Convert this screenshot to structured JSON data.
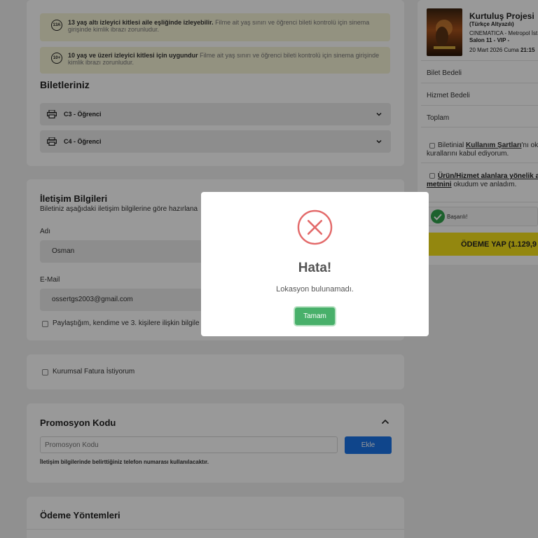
{
  "notices": [
    {
      "badge": "13A",
      "bold": "13 yaş altı izleyici kitlesi aile eşliğinde izleyebilir.",
      "text": " Filme ait yaş sınırı ve öğrenci bileti kontrolü için sinema girişinde kimlik ibrazı zorunludur."
    },
    {
      "badge": "10+",
      "bold": "10 yaş ve üzeri izleyici kitlesi için uygundur",
      "text": " Filme ait yaş sınırı ve öğrenci bileti kontrolü için sinema girişinde kimlik ibrazı zorunludur."
    }
  ],
  "tickets": {
    "heading": "Biletleriniz",
    "items": [
      {
        "label": "C3 - Öğrenci"
      },
      {
        "label": "C4 - Öğrenci"
      }
    ]
  },
  "contact": {
    "heading": "İletişim Bilgileri",
    "subtitle": "Biletiniz aşağıdaki iletişim bilgilerine göre hazırlana",
    "name_label": "Adı",
    "name_value": "Osman",
    "email_label": "E-Mail",
    "email_value": "ossertgs2003@gmail.com",
    "consent": "Paylaştığım, kendime ve 3. kişilere ilişkin bilgile"
  },
  "invoice": {
    "label": "Kurumsal Fatura İstiyorum"
  },
  "promo": {
    "heading": "Promosyon Kodu",
    "placeholder": "Promosyon Kodu",
    "apply_label": "Ekle",
    "note": "İletişim bilgilerinde belirttiğiniz telefon numarası kullanılacaktır."
  },
  "payment": {
    "heading": "Ödeme Yöntemleri"
  },
  "movie": {
    "title": "Kurtuluş Projesi",
    "subtitle": "(Türkçe Altyazılı)",
    "cinema": "CINEMATICA - Metropol İst",
    "hall": "Salon 11 - VIP -",
    "date": "20 Mart 2026 Cuma",
    "time": "21:15"
  },
  "summary": {
    "ticket_fee": "Bilet Bedeli",
    "service_fee": "Hizmet Bedeli",
    "total": "Toplam"
  },
  "terms": {
    "t1_pre": "Biletinial ",
    "t1_link": "Kullanım Şartları",
    "t1_post": "'nı ok",
    "t1_line2": "kurallarını kabul ediyorum.",
    "t2_link": "Ürün/Hizmet alanlara yönelik ay",
    "t2_link2": "metnini",
    "t2_post": " okudum ve anladım."
  },
  "captcha": {
    "label": "Başarılı!"
  },
  "pay_button": "ÖDEME YAP (1.129,9",
  "modal": {
    "title": "Hata!",
    "message": "Lokasyon bulunamadı.",
    "ok_label": "Tamam"
  },
  "colors": {
    "notice_bg": "#f6f3d6",
    "pay_button": "#f5e21a",
    "apply_button": "#1a73e8",
    "ok_button": "#48b06a",
    "error_red": "#e36a6a"
  }
}
